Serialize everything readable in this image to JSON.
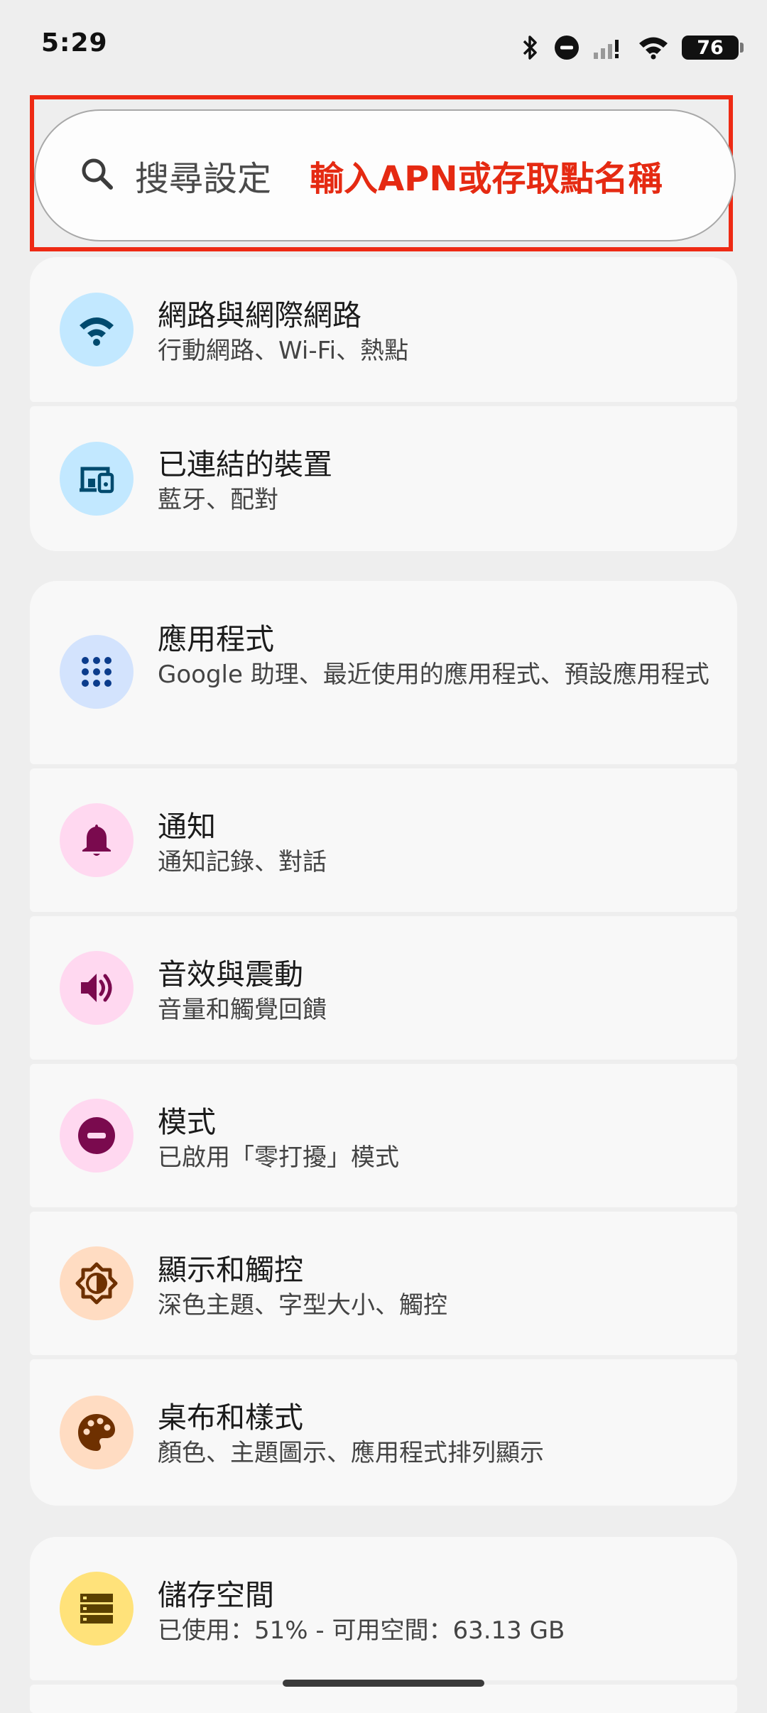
{
  "status_bar": {
    "time": "5:29",
    "battery": "76",
    "icons": [
      "bluetooth-icon",
      "do-not-disturb-icon",
      "signal-icon",
      "wifi-icon",
      "battery-icon"
    ]
  },
  "search": {
    "placeholder": "搜尋設定",
    "annotation": "輸入APN或存取點名稱",
    "annotation_color": "#e52a12"
  },
  "settings": [
    {
      "title": "網路與網際網路",
      "subtitle": "行動網路、Wi-Fi、熱點",
      "icon": "wifi-icon",
      "icon_bg": "#c2e8ff",
      "icon_color": "#004a6e"
    },
    {
      "title": "已連結的裝置",
      "subtitle": "藍牙、配對",
      "icon": "connected-devices-icon",
      "icon_bg": "#c2e8ff",
      "icon_color": "#004a6e"
    },
    {
      "title": "應用程式",
      "subtitle": "Google 助理、最近使用的應用程式、預設應用程式",
      "icon": "apps-grid-icon",
      "icon_bg": "#d3e3fd",
      "icon_color": "#0b3c8c"
    },
    {
      "title": "通知",
      "subtitle": "通知記錄、對話",
      "icon": "bell-icon",
      "icon_bg": "#ffd8f0",
      "icon_color": "#7a0a4e"
    },
    {
      "title": "音效與震動",
      "subtitle": "音量和觸覺回饋",
      "icon": "speaker-icon",
      "icon_bg": "#ffd8f0",
      "icon_color": "#7a0a4e"
    },
    {
      "title": "模式",
      "subtitle": "已啟用「零打擾」模式",
      "icon": "do-not-disturb-icon",
      "icon_bg": "#ffd8f0",
      "icon_color": "#7a0a4e"
    },
    {
      "title": "顯示和觸控",
      "subtitle": "深色主題、字型大小、觸控",
      "icon": "brightness-icon",
      "icon_bg": "#ffdcc2",
      "icon_color": "#6e3000"
    },
    {
      "title": "桌布和樣式",
      "subtitle": "顏色、主題圖示、應用程式排列顯示",
      "icon": "palette-icon",
      "icon_bg": "#ffdcc2",
      "icon_color": "#6e3000"
    },
    {
      "title": "儲存空間",
      "subtitle": "已使用：51% - 可用空間：63.13 GB",
      "icon": "storage-icon",
      "icon_bg": "#ffe27a",
      "icon_color": "#5a4000"
    }
  ]
}
